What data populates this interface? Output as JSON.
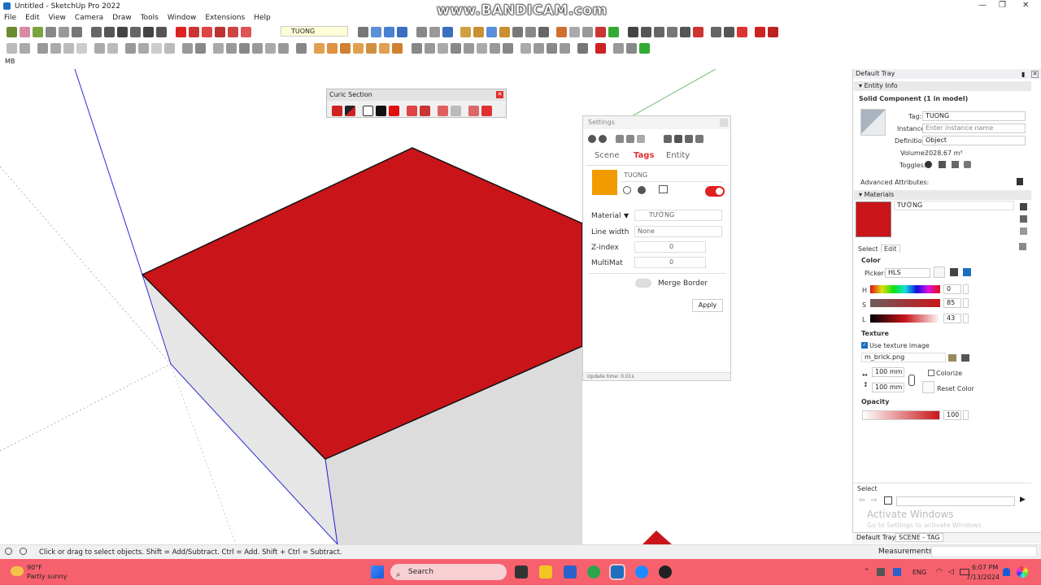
{
  "window": {
    "title": "Untitled - SketchUp Pro 2022",
    "watermark": "www.BANDICAM.com"
  },
  "menu": [
    "File",
    "Edit",
    "View",
    "Camera",
    "Draw",
    "Tools",
    "Window",
    "Extensions",
    "Help"
  ],
  "toolbar": {
    "tag_dropdown": "TUONG"
  },
  "mb_label": "MB",
  "curic": {
    "title": "Curic Section"
  },
  "settings": {
    "title": "Settings",
    "tabs": [
      "Scene",
      "Tags",
      "Entity"
    ],
    "active_tab": "Tags",
    "tag_name": "TUONG",
    "tag_color": "#f29b00",
    "material_label": "Material",
    "material_value": "TƯỜNG",
    "linewidth_label": "Line width",
    "linewidth_value": "None",
    "zindex_label": "Z-index",
    "zindex_value": "0",
    "multimat_label": "MultiMat",
    "multimat_value": "0",
    "merge_border_label": "Merge Border",
    "apply_label": "Apply",
    "update_time": "Update time: 0.01s"
  },
  "tray": {
    "title": "Default Tray",
    "entity_info": {
      "header": "Entity Info",
      "type": "Solid Component (1 in model)",
      "tag_label": "Tag:",
      "tag_value": "TUONG",
      "instance_label": "Instance:",
      "instance_placeholder": "Enter instance name",
      "definition_label": "Definition:",
      "definition_value": "Object",
      "volume_label": "Volume:",
      "volume_value": "2028.67 m³",
      "toggles_label": "Toggles:",
      "advanced_label": "Advanced Attributes:"
    },
    "materials": {
      "header": "Materials",
      "name": "TƯỜNG",
      "tabs": [
        "Select",
        "Edit"
      ],
      "color_label": "Color",
      "picker_label": "Picker:",
      "picker_value": "HLS",
      "h_label": "H",
      "h_value": "0",
      "s_label": "S",
      "s_value": "85",
      "l_label": "L",
      "l_value": "43",
      "texture_label": "Texture",
      "use_texture_label": "Use texture image",
      "texture_file": "m_brick.png",
      "width_value": "100 mm",
      "height_value": "100 mm",
      "colorize_label": "Colorize",
      "reset_color_label": "Reset Color",
      "opacity_label": "Opacity",
      "opacity_value": "100"
    },
    "select_label": "Select",
    "activate_title": "Activate Windows",
    "activate_sub": "Go to Settings to activate Windows.",
    "bottom_tabs": [
      "Default Tray",
      "SCENE - TAG"
    ]
  },
  "status": {
    "hint": "Click or drag to select objects. Shift = Add/Subtract. Ctrl = Add. Shift + Ctrl = Subtract.",
    "measurements_label": "Measurements"
  },
  "taskbar": {
    "weather_temp": "90°F",
    "weather_desc": "Partly sunny",
    "search_placeholder": "Search",
    "lang": "ENG",
    "time": "6:07 PM",
    "date": "7/13/2024"
  },
  "colors": {
    "material_red": "#c91519",
    "accent_orange": "#f29b00",
    "toggle_red": "#e02020",
    "taskbar": "#f6616d"
  }
}
